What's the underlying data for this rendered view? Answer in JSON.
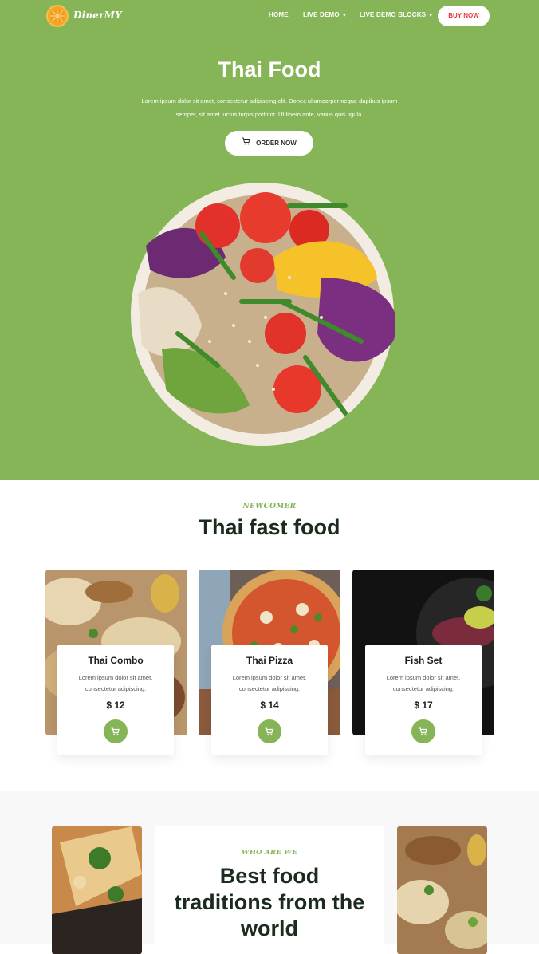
{
  "nav": {
    "brand": "DinerMY",
    "links": [
      "HOME",
      "LIVE DEMO",
      "LIVE DEMO BLOCKS"
    ],
    "buy_label": "BUY NOW"
  },
  "hero": {
    "title": "Thai Food",
    "subtitle_line1": "Lorem ipsum dolor sit amet, consectetur adipiscing elit. Donec ullamcorper neque dapibus ipsum",
    "subtitle_line2": "semper, sit amet luctus turpis porttitor. Ut libero ante, varius quis ligula.",
    "order_label": "ORDER NOW"
  },
  "newcomer": {
    "kicker": "NEWCOMER",
    "title": "Thai fast food",
    "items": [
      {
        "name": "Thai Combo",
        "desc": "Lorem ipsum dolor sit amet, consectetur adipiscing.",
        "price": "$ 12"
      },
      {
        "name": "Thai Pizza",
        "desc": "Lorem ipsum dolor sit amet, consectetur adipiscing.",
        "price": "$ 14"
      },
      {
        "name": "Fish Set",
        "desc": "Lorem ipsum dolor sit amet, consectetur adipiscing.",
        "price": "$ 17"
      }
    ]
  },
  "about": {
    "kicker": "WHO ARE WE",
    "title": "Best food traditions from the world"
  },
  "colors": {
    "accent": "#86b557",
    "buy_text": "#e8333a",
    "heading": "#1c2b1d"
  }
}
